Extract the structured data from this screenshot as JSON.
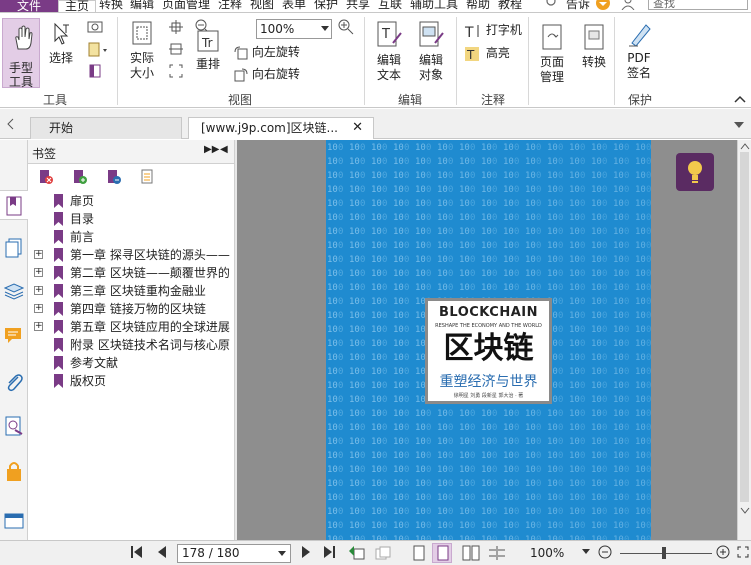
{
  "menu": {
    "file": "文件",
    "home": "主页",
    "items": [
      "转换",
      "编辑",
      "页面管理",
      "注释",
      "视图",
      "表单",
      "保护",
      "共享",
      "互联",
      "辅助工具",
      "帮助",
      "教程"
    ],
    "tell_me": "告诉",
    "search_placeholder": "查找"
  },
  "ribbon": {
    "hand_tool": "手型\n工具",
    "hand_tool_l1": "手型",
    "hand_tool_l2": "工具",
    "select": "选择",
    "tools_group": "工具",
    "actual_size_l1": "实际",
    "actual_size_l2": "大小",
    "zoom_value": "100%",
    "reflow": "重排",
    "rotate_left": "向左旋转",
    "rotate_right": "向右旋转",
    "view_group": "视图",
    "edit_text_l1": "编辑",
    "edit_text_l2": "文本",
    "edit_object_l1": "编辑",
    "edit_object_l2": "对象",
    "edit_group": "编辑",
    "typewriter": "打字机",
    "highlight": "高亮",
    "comment_group": "注释",
    "page_manage_l1": "页面",
    "page_manage_l2": "管理",
    "convert": "转换",
    "pdf_sign_l1": "PDF",
    "pdf_sign_l2": "签名",
    "protect_group": "保护"
  },
  "tabs": {
    "start": "开始",
    "document": "[www.j9p.com]区块链..."
  },
  "bookmarks": {
    "title": "书签",
    "items": [
      {
        "label": "扉页",
        "expandable": false
      },
      {
        "label": "目录",
        "expandable": false
      },
      {
        "label": "前言",
        "expandable": false
      },
      {
        "label": "第一章 探寻区块链的源头——",
        "expandable": true
      },
      {
        "label": "第二章 区块链——颠覆世界的",
        "expandable": true
      },
      {
        "label": "第三章 区块链重构金融业",
        "expandable": true
      },
      {
        "label": "第四章 链接万物的区块链",
        "expandable": true
      },
      {
        "label": "第五章 区块链应用的全球进展",
        "expandable": true
      },
      {
        "label": "附录 区块链技术名词与核心原",
        "expandable": false
      },
      {
        "label": "参考文献",
        "expandable": false
      },
      {
        "label": "版权页",
        "expandable": false
      }
    ]
  },
  "cover": {
    "title_en": "BLOCKCHAIN",
    "subtitle_en": "RESHAPE THE ECONOMY AND THE WORLD",
    "title_cn": "区块链",
    "subtitle_cn": "重塑经济与世界",
    "authors": "徐明星 刘勇 段新星 郭大治 · 著"
  },
  "status": {
    "page": "178 / 180",
    "zoom": "100%"
  },
  "colors": {
    "accent": "#7a3b86",
    "cover_blue": "#1f8bd0",
    "bookmark_flag": "#7a3b86"
  }
}
